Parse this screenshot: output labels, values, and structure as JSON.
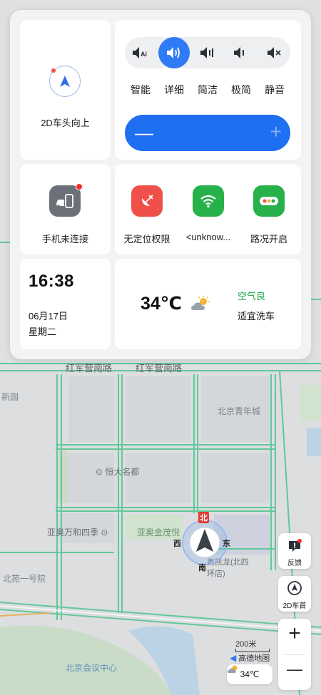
{
  "map": {
    "roads": [
      "红军营南路",
      "红军营南路"
    ],
    "areas": [
      "北京青年城",
      "新园",
      "北苑一号院",
      "北京会议中心"
    ],
    "pois": [
      "恒大名都",
      "亚奥万和四季",
      "亚奥金茂悦",
      "奥凯龙(北四环店)"
    ],
    "compass": {
      "north": "北",
      "south": "南",
      "west": "西",
      "east": "东"
    },
    "scale_text": "200米",
    "provider_label": "高德地图"
  },
  "heading_card": {
    "label": "2D车头向上",
    "icon": "navigation-arrow-icon"
  },
  "volume_card": {
    "modes": [
      {
        "label": "智能",
        "icon": "speaker-ai-icon",
        "active": false
      },
      {
        "label": "详细",
        "icon": "speaker-loud-icon",
        "active": true
      },
      {
        "label": "简洁",
        "icon": "speaker-medium-icon",
        "active": false
      },
      {
        "label": "极简",
        "icon": "speaker-low-icon",
        "active": false
      },
      {
        "label": "静音",
        "icon": "speaker-mute-icon",
        "active": false
      }
    ],
    "slider_minus": "—",
    "slider_plus": "+",
    "accent": "#1f6ff2"
  },
  "phone_card": {
    "label": "手机未连接",
    "icon": "phone-car-link-icon"
  },
  "status_card": {
    "items": [
      {
        "label": "无定位权限",
        "icon": "satellite-off-icon",
        "color": "#f0504a"
      },
      {
        "label": "<unknow...",
        "icon": "wifi-icon",
        "color": "#27b14a"
      },
      {
        "label": "路况开启",
        "icon": "traffic-light-icon",
        "color": "#27b14a"
      }
    ]
  },
  "time_card": {
    "time": "16:38",
    "date": "06月17日",
    "weekday": "星期二"
  },
  "weather_card": {
    "temperature": "34℃",
    "icon": "partly-cloudy-icon",
    "air_quality": "空气良",
    "car_wash": "适宜洗车"
  },
  "controls": {
    "feedback_label": "反馈",
    "car_heading_label": "2D车首",
    "zoom_in": "+",
    "zoom_out": "—",
    "weather_chip_temp": "34℃"
  }
}
